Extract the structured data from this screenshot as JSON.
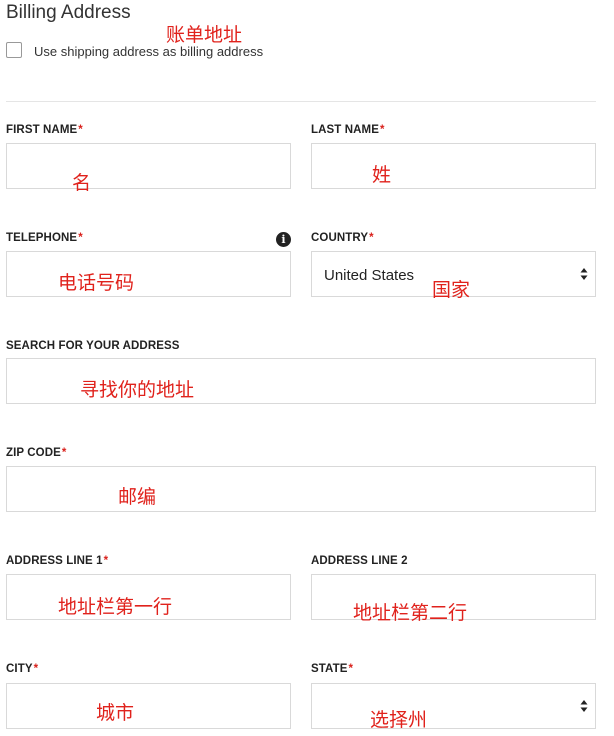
{
  "billing": {
    "title": "Billing Address",
    "title_note": "账单地址",
    "use_shipping_label": "Use shipping address as billing address"
  },
  "fields": {
    "first_name": {
      "label": "FIRST NAME",
      "required": "*",
      "note": "名"
    },
    "last_name": {
      "label": "LAST NAME",
      "required": "*",
      "note": "姓"
    },
    "telephone": {
      "label": "TELEPHONE",
      "required": "*",
      "note": "电话号码",
      "icon": "info-icon"
    },
    "country": {
      "label": "COUNTRY",
      "required": "*",
      "value": "United States",
      "note": "国家",
      "icon": "select-chevron-icon"
    },
    "search_address": {
      "label": "SEARCH FOR YOUR ADDRESS",
      "note": "寻找你的地址"
    },
    "zip": {
      "label": "ZIP CODE",
      "required": "*",
      "note": "邮编"
    },
    "address1": {
      "label": "ADDRESS LINE 1",
      "required": "*",
      "note": "地址栏第一行"
    },
    "address2": {
      "label": "ADDRESS LINE 2",
      "note": "地址栏第二行"
    },
    "city": {
      "label": "CITY",
      "required": "*",
      "note": "城市"
    },
    "state": {
      "label": "STATE",
      "required": "*",
      "note": "选择州",
      "icon": "select-chevron-icon"
    }
  },
  "colors": {
    "required": "#d9211c",
    "annotation": "#e0221c",
    "border": "#d9d9d9"
  }
}
